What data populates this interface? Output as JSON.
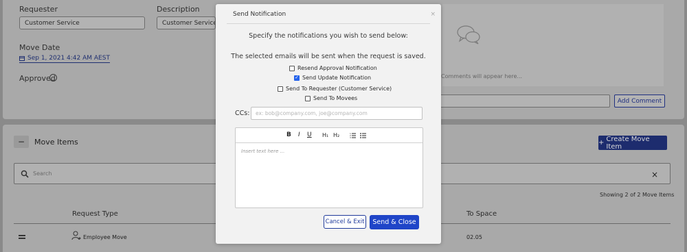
{
  "request": {
    "requester_label": "Requester",
    "requester_value": "Customer Service",
    "description_label": "Description",
    "description_value": "Customer Service's Sc",
    "move_date_label": "Move Date",
    "move_date_value": "Sep 1, 2021 4:42 AM AEST",
    "approved_label": "Approved"
  },
  "comments": {
    "placeholder": "Comments will appear here...",
    "add_button": "Add Comment"
  },
  "move_items": {
    "collapse_symbol": "−",
    "title": "Move Items",
    "create_button": "Create Move Item",
    "search_placeholder": "Search",
    "clear_symbol": "×",
    "showing": "Showing 2 of 2 Move Items",
    "columns": [
      "Request Type",
      "To Space"
    ],
    "rows": [
      {
        "request_type": "Employee Move",
        "to_space": "02.05"
      }
    ]
  },
  "modal": {
    "title": "Send Notification",
    "close_symbol": "×",
    "intro": "Specify the notifications you wish to send below:",
    "note": "The selected emails will be sent when the request is saved.",
    "options": [
      {
        "label": "Resend Approval Notification",
        "checked": false
      },
      {
        "label": "Send Update Notification",
        "checked": true
      },
      {
        "label": "Send To Requester (Customer Service)",
        "checked": false
      },
      {
        "label": "Send To Movees",
        "checked": false
      }
    ],
    "ccs_label": "CCs:",
    "ccs_placeholder": "ex: bob@company.com, joe@company.com",
    "editor_toolbar": {
      "bold": "B",
      "italic": "I",
      "underline": "U",
      "h1": "H₁",
      "h2": "H₂"
    },
    "editor_placeholder": "Insert text here ...",
    "cancel_button": "Cancel & Exit",
    "send_button": "Send & Close"
  },
  "colors": {
    "primary": "#1f45c8",
    "overlay_background": "#8a8a8a",
    "checkbox_checked": "#2563eb"
  }
}
